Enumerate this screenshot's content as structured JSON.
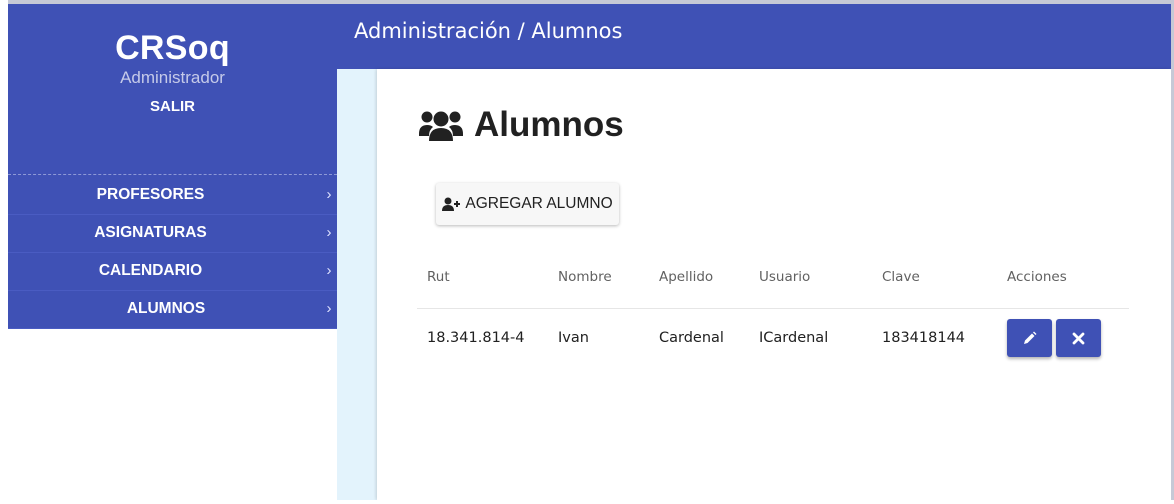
{
  "sidebar": {
    "brand": "CRSoq",
    "role": "Administrador",
    "logout": "SALIR",
    "items": [
      {
        "label": "PROFESORES"
      },
      {
        "label": "ASIGNATURAS"
      },
      {
        "label": "CALENDARIO"
      },
      {
        "label": "ALUMNOS"
      }
    ],
    "chevron": "›"
  },
  "header": {
    "breadcrumb": "Administración / Alumnos"
  },
  "main": {
    "title": "Alumnos",
    "title_icon": "users-icon",
    "add_button": "AGREGAR ALUMNO",
    "add_icon": "user-plus-icon",
    "table": {
      "headers": [
        "Rut",
        "Nombre",
        "Apellido",
        "Usuario",
        "Clave",
        "Acciones"
      ],
      "rows": [
        {
          "rut": "18.341.814-4",
          "nombre": "Ivan",
          "apellido": "Cardenal",
          "usuario": "ICardenal",
          "clave": "183418144"
        }
      ],
      "actions": [
        "pencil-icon",
        "close-icon"
      ]
    }
  },
  "colors": {
    "primary": "#3f51b5",
    "content_bg": "#e3f3fc"
  }
}
